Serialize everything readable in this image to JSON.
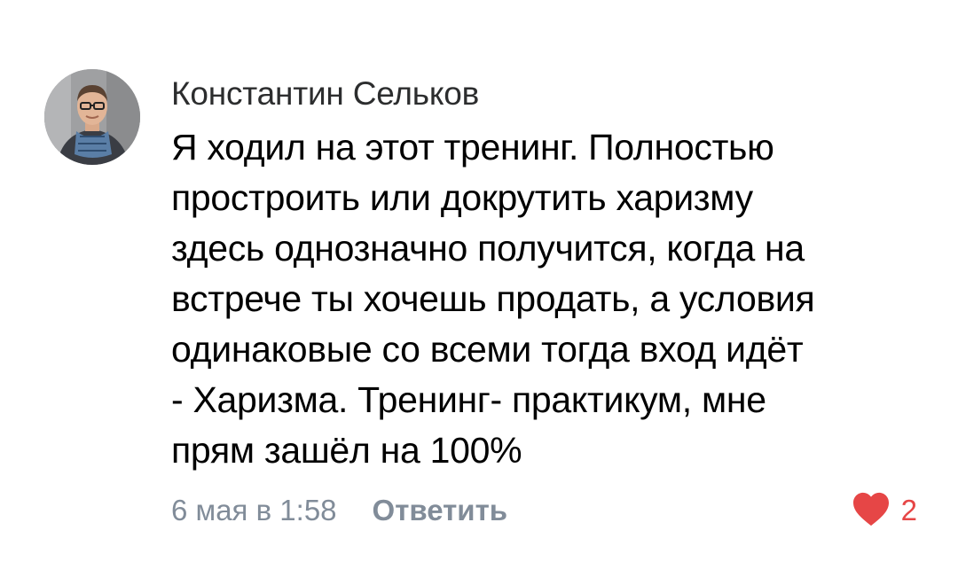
{
  "comment": {
    "author": "Константин Сельков",
    "text": "Я ходил на этот тренинг. Полностью\nпростроить или докрутить харизму\nздесь однозначно получится, когда на\nвстрече ты хочешь продать, а условия\nодинаковые со всеми тогда вход идёт\n- Харизма. Тренинг- практикум, мне\nпрям зашёл на 100%",
    "date": "6 мая в 1:58",
    "reply_label": "Ответить",
    "likes": "2",
    "liked": true,
    "like_icon": "heart-icon",
    "colors": {
      "like_accent": "#e64646",
      "meta_text": "#818c99",
      "author_text": "#2c2d2e"
    }
  }
}
